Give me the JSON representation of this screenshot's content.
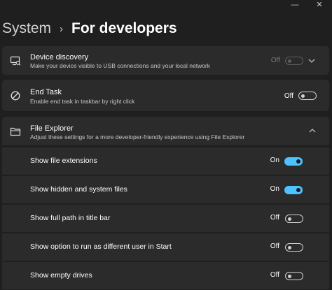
{
  "window": {
    "minimize_glyph": "—",
    "close_glyph": "✕"
  },
  "breadcrumb": {
    "parent": "System",
    "separator": "›",
    "current": "For developers"
  },
  "device_discovery": {
    "title": "Device discovery",
    "subtitle": "Make your device visible to USB connections and your local network",
    "state": "Off",
    "enabled": false,
    "icon": "device-discovery-icon"
  },
  "end_task": {
    "title": "End Task",
    "subtitle": "Enable end task in taskbar by right click",
    "state": "Off",
    "icon": "prohibited-icon"
  },
  "file_explorer": {
    "title": "File Explorer",
    "subtitle": "Adjust these settings for a more developer-friendly experience using File Explorer",
    "icon": "folder-icon",
    "expanded": true,
    "settings": [
      {
        "label": "Show file extensions",
        "state": "On"
      },
      {
        "label": "Show hidden and system files",
        "state": "On"
      },
      {
        "label": "Show full path in title bar",
        "state": "Off"
      },
      {
        "label": "Show option to run as different user in Start",
        "state": "Off"
      },
      {
        "label": "Show empty drives",
        "state": "Off"
      }
    ]
  },
  "colors": {
    "accent": "#4cc2ff",
    "card": "#2b2b2b",
    "background": "#1f1f1f"
  }
}
